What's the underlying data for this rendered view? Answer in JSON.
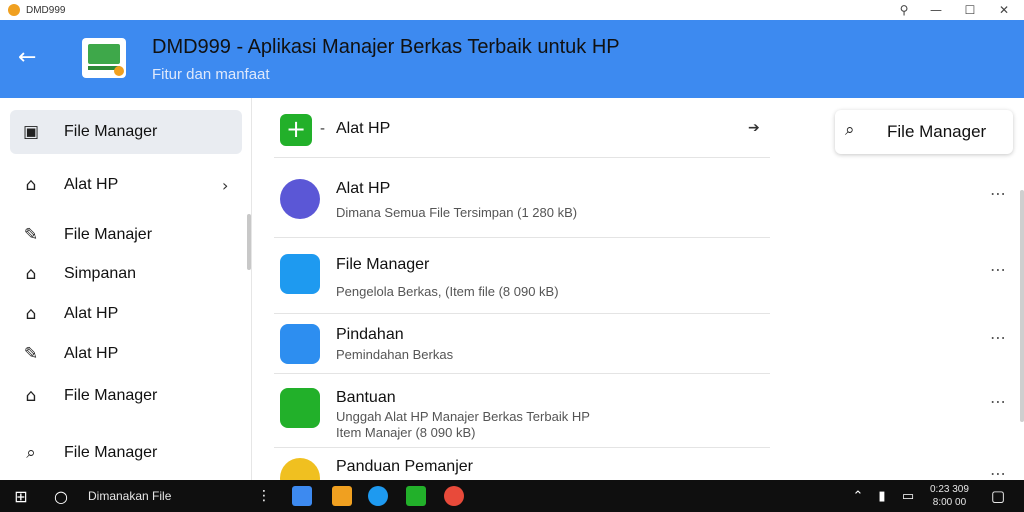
{
  "window": {
    "title": "DMD999",
    "controls": [
      "⚲",
      "—",
      "☐",
      "✕"
    ]
  },
  "header": {
    "back_icon": "←",
    "title": "DMD999 - Aplikasi Manajer Berkas Terbaik untuk HP",
    "subtitle": "Fitur dan manfaat"
  },
  "sidebar": {
    "items": [
      {
        "label": "File Manager",
        "icon": "▣",
        "selected": true
      },
      {
        "label": "Alat HP",
        "icon": "⌂",
        "chevron": "›"
      },
      {
        "label": "File Manajer",
        "icon": "✎"
      },
      {
        "label": "Simpanan",
        "icon": "⌂"
      },
      {
        "label": "Alat HP",
        "icon": "⌂"
      },
      {
        "label": "Alat HP",
        "icon": "✎"
      },
      {
        "label": "File Manager",
        "icon": "⌂"
      },
      {
        "label": "File Manager",
        "icon": "⌕"
      }
    ]
  },
  "top_row": {
    "icon": "+",
    "dash": "-",
    "label": "Alat HP",
    "arrow": "➔"
  },
  "search": {
    "icon": "⌕",
    "text": "File Manager"
  },
  "list": [
    {
      "title": "Alat HP",
      "subtitle": "Dimana Semua File Tersimpan (1 280 kB)",
      "color": "#5b57d6"
    },
    {
      "title": "File Manager",
      "subtitle": "Pengelola Berkas, (Item file (8 090 kB)",
      "color": "#1e9af0"
    },
    {
      "title": "Pindahan",
      "subtitle": "Pemindahan Berkas",
      "color": "#2d8ef0"
    },
    {
      "title": "Bantuan",
      "subtitle": "Unggah Alat HP Manajer Berkas Terbaik HP",
      "subtitle2": "Item Manajer (8 090 kB)",
      "color": "#22b02a"
    },
    {
      "title": "Panduan Pemanjer",
      "subtitle": "",
      "color": "#f0c020"
    }
  ],
  "more_icon": "⋯",
  "taskbar": {
    "start_icon": "⊞",
    "search_icon": "○",
    "search_text": "Dimanakan File",
    "menu_icon": "⋮",
    "apps": [
      {
        "name": "explorer",
        "color": "#3d8af0"
      },
      {
        "name": "photos",
        "color": "#f0a020"
      },
      {
        "name": "edge",
        "color": "#1e9af0"
      },
      {
        "name": "store",
        "color": "#22b02a"
      },
      {
        "name": "chrome",
        "color": "#e84a3a"
      }
    ],
    "tray": [
      "⌃",
      "▮",
      "▭"
    ],
    "time": "0:23 309",
    "date": "8:00 00",
    "notify_icon": "▢"
  },
  "colors": {
    "accent": "#3d8af0",
    "green": "#22b02a",
    "sidebar_selected": "#e9ecf1"
  }
}
